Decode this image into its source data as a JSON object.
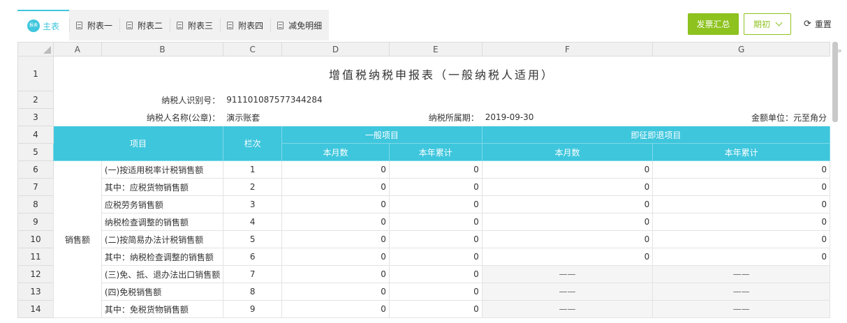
{
  "tabs": [
    {
      "label": "主表",
      "icon_text": "报表"
    },
    {
      "label": "附表一"
    },
    {
      "label": "附表二"
    },
    {
      "label": "附表三"
    },
    {
      "label": "附表四"
    },
    {
      "label": "减免明细"
    }
  ],
  "toolbar": {
    "invoice_summary": "发票汇总",
    "period": "期初",
    "reset": "重置"
  },
  "columns": [
    "A",
    "B",
    "C",
    "D",
    "E",
    "F",
    "G"
  ],
  "form": {
    "title": "增值税纳税申报表（一般纳税人适用）",
    "taxpayer_id_label": "纳税人识别号：",
    "taxpayer_id": "911101087577344284",
    "taxpayer_name_label": "纳税人名称(公章)：",
    "taxpayer_name": "演示账套",
    "period_label": "纳税所属期：",
    "period": "2019-09-30",
    "unit": "金额单位：元至角分"
  },
  "headers": {
    "item": "项目",
    "column_no": "栏次",
    "general": "一般项目",
    "refund": "即征即退项目",
    "month": "本月数",
    "year": "本年累计"
  },
  "category": "销售额",
  "rows": [
    {
      "rownum": "6",
      "item": "(一)按适用税率计税销售额",
      "no": "1",
      "d": "0",
      "e": "0",
      "f": "0",
      "g": "0"
    },
    {
      "rownum": "7",
      "item": "其中：应税货物销售额",
      "no": "2",
      "d": "0",
      "e": "0",
      "f": "0",
      "g": "0"
    },
    {
      "rownum": "8",
      "item": "应税劳务销售额",
      "no": "3",
      "d": "0",
      "e": "0",
      "f": "0",
      "g": "0"
    },
    {
      "rownum": "9",
      "item": "纳税检查调整的销售额",
      "no": "4",
      "d": "0",
      "e": "0",
      "f": "0",
      "g": "0"
    },
    {
      "rownum": "10",
      "item": "(二)按简易办法计税销售额",
      "no": "5",
      "d": "0",
      "e": "0",
      "f": "0",
      "g": "0"
    },
    {
      "rownum": "11",
      "item": "其中：纳税检查调整的销售额",
      "no": "6",
      "d": "0",
      "e": "0",
      "f": "0",
      "g": "0"
    },
    {
      "rownum": "12",
      "item": "(三)免、抵、退办法出口销售额",
      "no": "7",
      "d": "0",
      "e": "0",
      "f": "——",
      "g": "——"
    },
    {
      "rownum": "13",
      "item": "(四)免税销售额",
      "no": "8",
      "d": "0",
      "e": "0",
      "f": "——",
      "g": "——"
    },
    {
      "rownum": "14",
      "item": "其中：免税货物销售额",
      "no": "9",
      "d": "0",
      "e": "0",
      "f": "——",
      "g": "——"
    }
  ],
  "rownums": [
    "1",
    "2",
    "3",
    "4",
    "5"
  ]
}
